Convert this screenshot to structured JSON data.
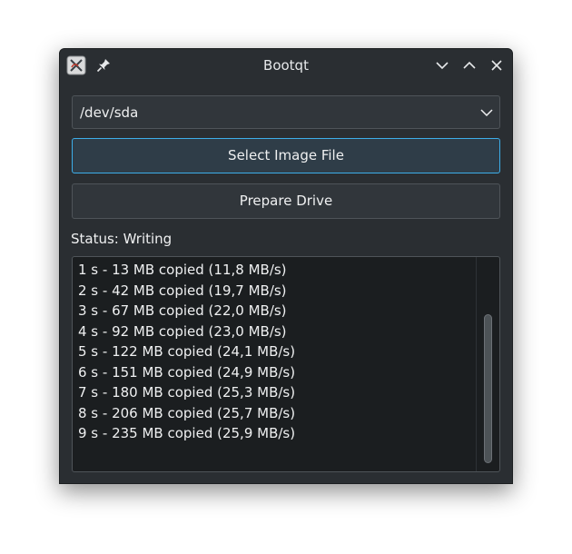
{
  "window": {
    "title": "Bootqt"
  },
  "titlebar_icons": {
    "app": "app-logo-icon",
    "pin": "pin-icon",
    "minimize": "chevron-down-icon",
    "maximize": "chevron-up-icon",
    "close": "close-icon"
  },
  "drive_select": {
    "value": "/dev/sda"
  },
  "buttons": {
    "select_image": "Select Image File",
    "prepare_drive": "Prepare Drive"
  },
  "status": {
    "text": "Status: Writing"
  },
  "log": {
    "lines": [
      "1 s - 13 MB copied (11,8 MB/s)",
      "2 s - 42 MB copied (19,7 MB/s)",
      "3 s - 67 MB copied (22,0 MB/s)",
      "4 s - 92 MB copied (23,0 MB/s)",
      "5 s - 122 MB copied (24,1 MB/s)",
      "6 s - 151 MB copied (24,9 MB/s)",
      "7 s - 180 MB copied (25,3 MB/s)",
      "8 s - 206 MB copied (25,7 MB/s)",
      "9 s - 235 MB copied (25,9 MB/s)"
    ]
  },
  "colors": {
    "window_bg": "#2a2e32",
    "accent": "#3daee9",
    "text": "#eff0f1",
    "log_bg": "#1b1e20"
  }
}
